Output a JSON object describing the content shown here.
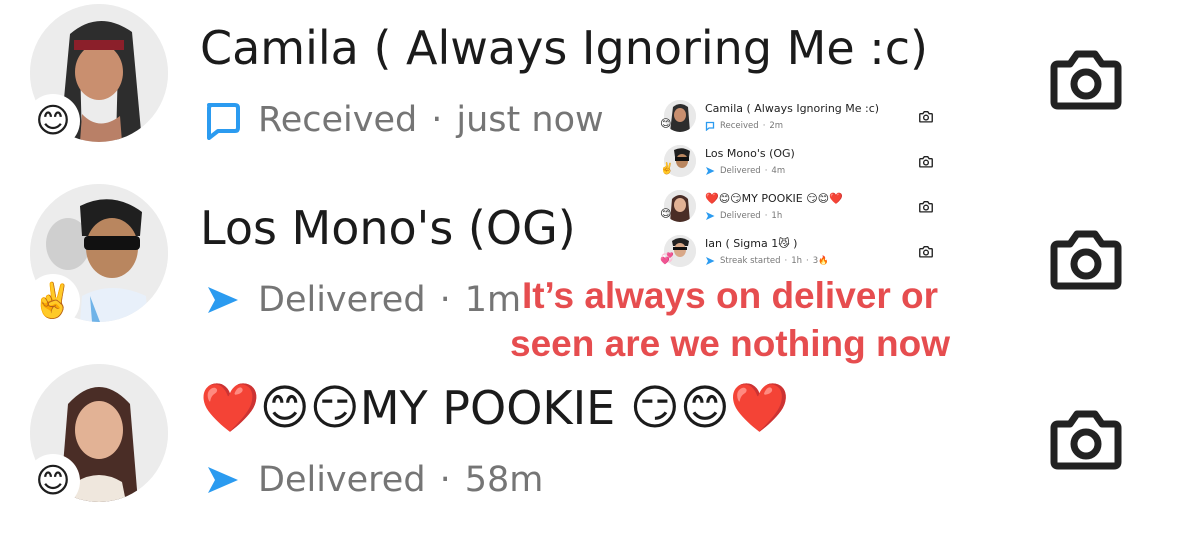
{
  "chats": [
    {
      "name": "Camila ( Always Ignoring Me :c)",
      "status_icon": "received-chat-icon",
      "status_text": "Received",
      "time": "just now",
      "badge_emoji": "😊",
      "avatar": "girl-headband-bitmoji"
    },
    {
      "name": "Los Mono's  (OG)",
      "status_icon": "delivered-arrow-icon",
      "status_text": "Delivered",
      "time": "1m",
      "badge_emoji": "✌️",
      "avatar": "boy-sunglasses-bitmoji"
    },
    {
      "name_prefix": "❤️😊😏",
      "name_text": "MY POOKIE ",
      "name_suffix": "😏😊❤️",
      "status_icon": "delivered-arrow-icon",
      "status_text": "Delivered",
      "time": "58m",
      "badge_emoji": "😊",
      "avatar": "girl-long-hair-bitmoji"
    }
  ],
  "inset": {
    "chats": [
      {
        "name": "Camila ( Always Ignoring Me :c)",
        "status_text": "Received",
        "time": "2m",
        "badge_emoji": "😊"
      },
      {
        "name": "Los Mono's  (OG)",
        "status_text": "Delivered",
        "time": "4m",
        "badge_emoji": "✌️"
      },
      {
        "name": "❤️😊😏MY POOKIE 😏😊❤️",
        "status_text": "Delivered",
        "time": "1h",
        "badge_emoji": "😊"
      },
      {
        "name": "Ian ( Sigma 1😼 )",
        "status_text": "Streak started",
        "time": "1h",
        "streak": "3🔥",
        "badge_emoji": "💞"
      }
    ]
  },
  "overlay_caption": "It’s always on deliver or seen are we nothing now",
  "colors": {
    "accent_blue": "#2b9bf0",
    "caption_red": "#e64d4f",
    "status_gray": "#757575"
  },
  "dot": "·"
}
